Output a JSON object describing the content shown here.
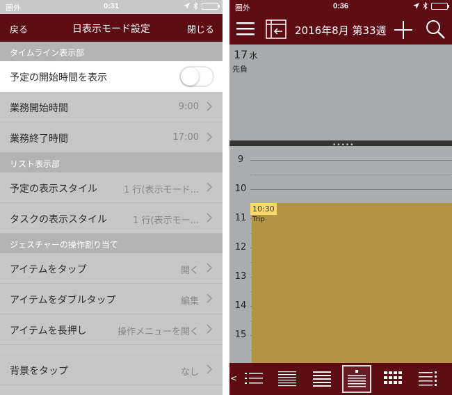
{
  "left": {
    "status": {
      "carrier": "圏外",
      "time": "0:31"
    },
    "nav": {
      "back": "戻る",
      "title": "日表示モード設定",
      "close": "閉じる"
    },
    "sections": {
      "timeline": "タイムライン表示部",
      "list": "リスト表示部",
      "gesture": "ジェスチャーの操作割り当て"
    },
    "rows": {
      "show_start": {
        "label": "予定の開始時間を表示",
        "on": false
      },
      "work_start": {
        "label": "業務開始時間",
        "value": "9:00"
      },
      "work_end": {
        "label": "業務終了時間",
        "value": "17:00"
      },
      "event_style": {
        "label": "予定の表示スタイル",
        "value": "1 行(表示モード..."
      },
      "task_style": {
        "label": "タスクの表示スタイル",
        "value": "1 行(表示モー..."
      },
      "tap": {
        "label": "アイテムをタップ",
        "value": "開く"
      },
      "double_tap": {
        "label": "アイテムをダブルタップ",
        "value": "編集"
      },
      "long_press": {
        "label": "アイテムを長押し",
        "value": "操作メニューを開く"
      },
      "bg_tap": {
        "label": "背景をタップ",
        "value": "なし"
      }
    }
  },
  "right": {
    "status": {
      "carrier": "圏外",
      "time": "0:36"
    },
    "nav": {
      "title": "2016年8月 第33週"
    },
    "day": {
      "number": "17",
      "weekday": "水",
      "rokuyo": "先負"
    },
    "hours": [
      "9",
      "10",
      "11",
      "12",
      "13",
      "14",
      "15"
    ],
    "event": {
      "time": "10:30",
      "title": "Trip"
    },
    "tabbar": {
      "prev": "<"
    }
  },
  "colors": {
    "header": "#5d0c14",
    "event": "#b39345",
    "event_time_bg": "#f6d86b",
    "battery": "#5ad43b"
  },
  "icons": {
    "location": "location-arrow-icon",
    "bluetooth": "bluetooth-icon",
    "battery": "battery-icon",
    "menu": "hamburger-menu-icon",
    "move": "move-to-date-icon",
    "add": "plus-icon",
    "search": "magnifier-icon"
  }
}
